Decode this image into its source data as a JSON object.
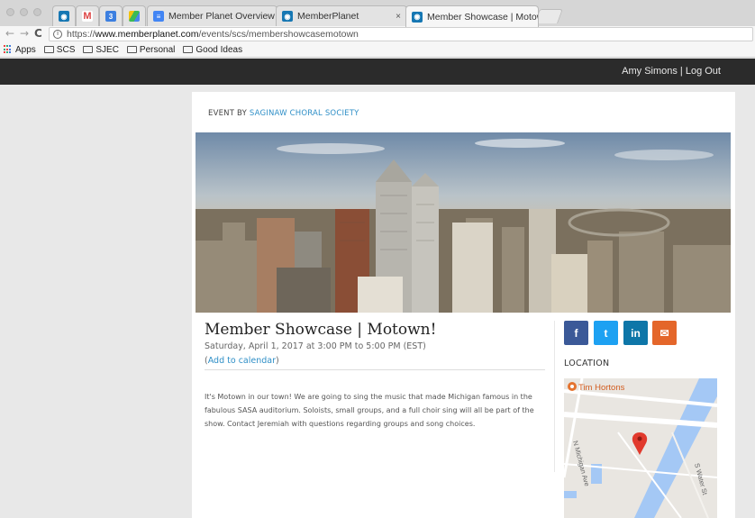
{
  "browser": {
    "tabs": [
      {
        "label": "Member Planet Overview - Sin",
        "icon": "google-docs-icon"
      },
      {
        "label": "MemberPlanet",
        "icon": "memberplanet-icon"
      },
      {
        "label": "Member Showcase | Motown!",
        "icon": "memberplanet-icon",
        "active": true
      }
    ],
    "tab_close": "×",
    "url_scheme": "https://",
    "url_domain": "www.memberplanet.com",
    "url_path": "/events/scs/membershowcasemotown",
    "info_glyph": "i",
    "nav": {
      "back": "←",
      "forward": "→",
      "reload": "C"
    },
    "bookmarks": [
      "Apps",
      "SCS",
      "SJEC",
      "Personal",
      "Good Ideas"
    ]
  },
  "site": {
    "user_links": "Amy Simons | Log Out"
  },
  "event": {
    "event_by_prefix": "EVENT BY ",
    "organizer": "SAGINAW CHORAL SOCIETY",
    "title": "Member Showcase | Motown!",
    "datetime": "Saturday, April 1, 2017 at 3:00 PM to 5:00 PM (EST)",
    "add_calendar_open": "(",
    "add_calendar": "Add to calendar",
    "add_calendar_close": ")",
    "description": "It's Motown in our town! We are going to sing the music that made Michigan famous in the fabulous SASA auditorium. Soloists, small groups, and a full choir sing will all be part of the show. Contact Jeremiah with questions regarding groups and song choices."
  },
  "share": [
    {
      "name": "facebook",
      "glyph": "f",
      "color": "#3b5998"
    },
    {
      "name": "twitter",
      "glyph": "t",
      "color": "#1da1f2"
    },
    {
      "name": "linkedin",
      "glyph": "in",
      "color": "#0e76a8"
    },
    {
      "name": "email",
      "glyph": "✉",
      "color": "#e4662a"
    }
  ],
  "location": {
    "heading": "LOCATION",
    "map_labels": {
      "poi": "Tim Hortons",
      "street1": "N Michigan Ave",
      "street2": "S Water St"
    }
  },
  "colors": {
    "link": "#2f8fc7",
    "topbar": "#2b2b2b",
    "river": "#a4c8f5"
  }
}
